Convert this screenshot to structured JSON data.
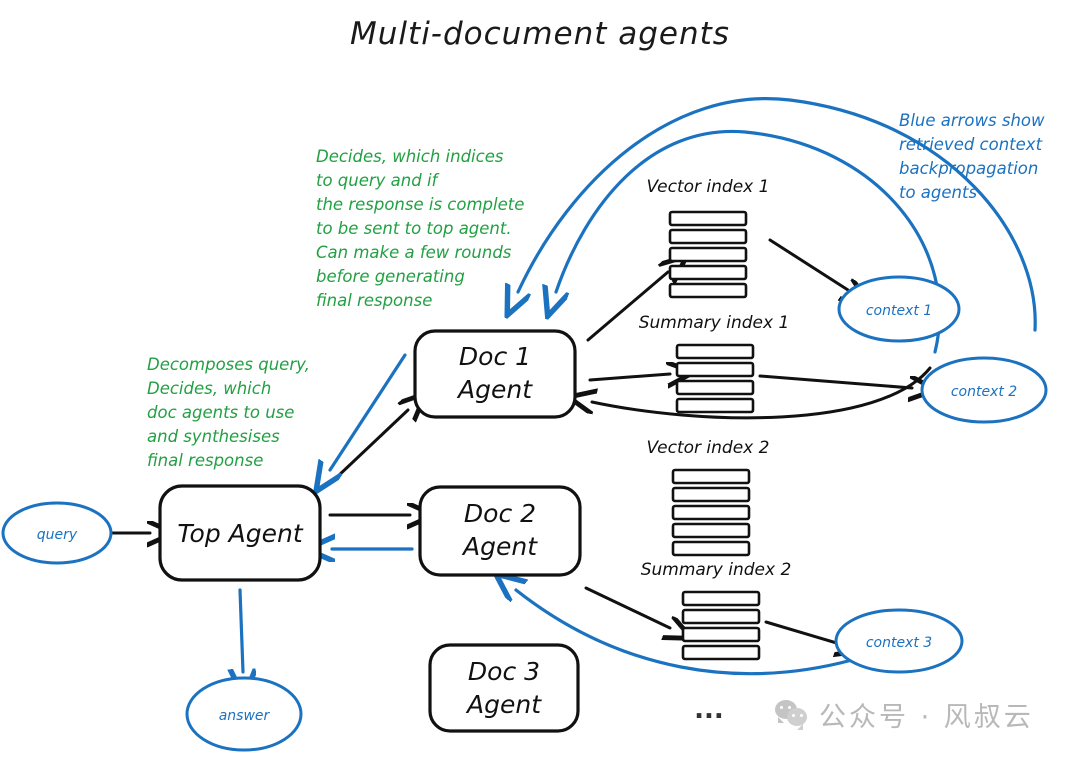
{
  "title": "Multi-document agents",
  "diagram": {
    "type": "flow-diagram",
    "nodes": {
      "query": "query",
      "answer": "answer",
      "top_agent": {
        "line1": "Top Agent"
      },
      "doc1_agent": {
        "line1": "Doc 1",
        "line2": "Agent"
      },
      "doc2_agent": {
        "line1": "Doc 2",
        "line2": "Agent"
      },
      "doc3_agent": {
        "line1": "Doc 3",
        "line2": "Agent"
      },
      "vector_index_1": "Vector index 1",
      "summary_index_1": "Summary index 1",
      "vector_index_2": "Vector index 2",
      "summary_index_2": "Summary index 2",
      "context1": "context 1",
      "context2": "context 2",
      "context3": "context 3",
      "ellipsis": "..."
    },
    "index_bar_counts": {
      "vector_index_1": 5,
      "summary_index_1": 4,
      "vector_index_2": 5,
      "summary_index_2": 4
    },
    "annotations": {
      "top_agent_note": {
        "color": "#22a043",
        "lines": [
          "Decomposes query,",
          "Decides, which",
          "doc agents to use",
          "and synthesises",
          " final response"
        ]
      },
      "doc_agent_note": {
        "color": "#22a043",
        "lines": [
          "Decides, which indices",
          "to query and if",
          "the response is complete",
          "to be sent to top agent.",
          "Can make a few rounds",
          "before generating",
          "final response"
        ]
      },
      "blue_legend": {
        "color": "#1b72c0",
        "lines": [
          "Blue arrows show",
          "retrieved context",
          "backpropagation",
          "to agents"
        ]
      }
    },
    "colors": {
      "ink": "#111111",
      "blue": "#1b72c0",
      "green": "#22a043",
      "background": "#ffffff",
      "watermark": "#bdbdbd"
    }
  },
  "watermark": {
    "text": "公众号 · 风叔云",
    "icon": "wechat-icon"
  }
}
